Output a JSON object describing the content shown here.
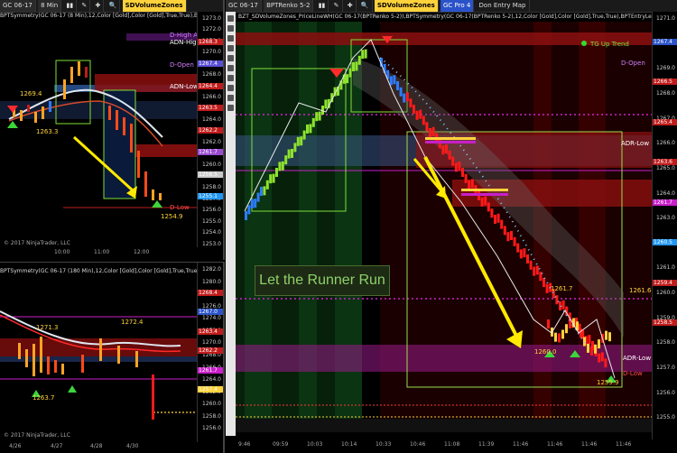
{
  "left_top": {
    "toolbar": {
      "instrument": "GC 06-17",
      "interval": "8 Min",
      "sdz": "SDVolumeZones"
    },
    "study_title": "BPTSymmetry(GC 06-17 (8 Min),12,Color [Gold],Color [Gold],True,True),BPTEntryLevel",
    "price_ticks": [
      "1273.0",
      "1272.0",
      "1271.0",
      "1270.0",
      "1269.0",
      "1268.0",
      "1267.0",
      "1266.0",
      "1265.0",
      "1264.0",
      "1263.0",
      "1262.0",
      "1261.0",
      "1260.0",
      "1259.0",
      "1258.0",
      "1257.0",
      "1256.0",
      "1255.0",
      "1254.0",
      "1253.0"
    ],
    "price_boxes": [
      {
        "text": "1268.3",
        "color": "#c01b1b"
      },
      {
        "text": "1267.4",
        "color": "#5a4fd4"
      },
      {
        "text": "1264.4",
        "color": "#c01b1b"
      },
      {
        "text": "1263.5",
        "color": "#c01b1b"
      },
      {
        "text": "1262.2",
        "color": "#c01b1b"
      },
      {
        "text": "1261.7",
        "color": "#9a4bd1"
      },
      {
        "text": "1256.5",
        "color": "#c9c9c9"
      },
      {
        "text": "1255.1",
        "color": "#2196f3"
      }
    ],
    "levels": {
      "d_high_adr": "D-High ADR",
      "adr_high": "ADN-High",
      "d_open": "D-Open",
      "adr_low": "ADN-Low",
      "d_low": "D-Low"
    },
    "price_labels": {
      "p1": "1269.4",
      "p2": "1263.3",
      "p3": "1254.9"
    },
    "time_labels": [
      "10:00",
      "11:00",
      "12:00"
    ],
    "copyright": "© 2017 NinjaTrader, LLC"
  },
  "left_bottom": {
    "study_title": "BPTSymmetry(GC 06-17 (180 Min),12,Color [Gold],Color [Gold],True,True),BPTEntryLevelV2",
    "price_ticks": [
      "1282.0",
      "1280.0",
      "1278.0",
      "1276.0",
      "1274.0",
      "1272.0",
      "1270.0",
      "1268.0",
      "1266.0",
      "1264.0",
      "1262.0",
      "1260.0",
      "1258.0",
      "1256.0"
    ],
    "price_labels": {
      "p1": "1271.3",
      "p2": "1272.4",
      "p3": "1263.7"
    },
    "price_boxes": [
      {
        "text": "1268.4",
        "color": "#c01b1b"
      },
      {
        "text": "1267.0",
        "color": "#2b53c9"
      },
      {
        "text": "1263.4",
        "color": "#c01b1b"
      },
      {
        "text": "1262.2",
        "color": "#c01b1b"
      },
      {
        "text": "1261.7",
        "color": "#c81fc9"
      },
      {
        "text": "1257.4",
        "color": "#ffd23c"
      }
    ],
    "time_labels": [
      "4/26",
      "4/27",
      "4/28",
      "4/30"
    ],
    "copyright": "© 2017 NinjaTrader, LLC"
  },
  "right": {
    "toolbar": {
      "instrument": "GC 06-17",
      "chart": "BPTRenko 5-2",
      "sdz": "SDVolumeZones",
      "tab1": "GC Pro 4",
      "tab2": "Don Entry Map"
    },
    "study_title": "BZT_SDVolumeZones_PriceLineWH(GC 06-17(BPTRenko 5-2)),BPTSymmetry(GC 06-17(BPTRenko 5-2),12,Color [Gold],Color [Gold],True,True),BPTEntryLevelV2(GC 06-17(BPT",
    "trend_label": "TG Up Trend",
    "levels": {
      "d_open": "D-Open",
      "adr_low": "ADR-Low",
      "adr_low2": "ADR-Low",
      "d_low": "D-Low"
    },
    "callout": "Let the Runner Run",
    "price_labels": {
      "p1": "1261.7",
      "p2": "1261.6",
      "p3": "1260.0",
      "p4": "1259.9"
    },
    "price_ticks": [
      "1271.0",
      "1270.0",
      "1269.0",
      "1268.0",
      "1267.0",
      "1266.0",
      "1265.0",
      "1264.0",
      "1263.0",
      "1262.0",
      "1261.0",
      "1260.0",
      "1259.0",
      "1258.0",
      "1257.0",
      "1256.0",
      "1255.0"
    ],
    "price_boxes": [
      {
        "text": "1267.4",
        "color": "#2b53c9"
      },
      {
        "text": "1266.5",
        "color": "#c01b1b"
      },
      {
        "text": "1265.4",
        "color": "#c01b1b"
      },
      {
        "text": "1263.6",
        "color": "#c01b1b"
      },
      {
        "text": "1261.7",
        "color": "#c81fc9"
      },
      {
        "text": "1260.5",
        "color": "#2196f3"
      },
      {
        "text": "1259.4",
        "color": "#c01b1b"
      },
      {
        "text": "1258.5",
        "color": "#c01b1b"
      }
    ],
    "time_labels": [
      "9:46",
      "09:59",
      "10:03",
      "10:14",
      "10:33",
      "10:46",
      "11:08",
      "11:39",
      "11:46",
      "11:46",
      "11:46",
      "11:46"
    ],
    "colors": {
      "up": "#8ee22e",
      "down": "#ff1a1a",
      "accent": "#ffd23c"
    }
  }
}
